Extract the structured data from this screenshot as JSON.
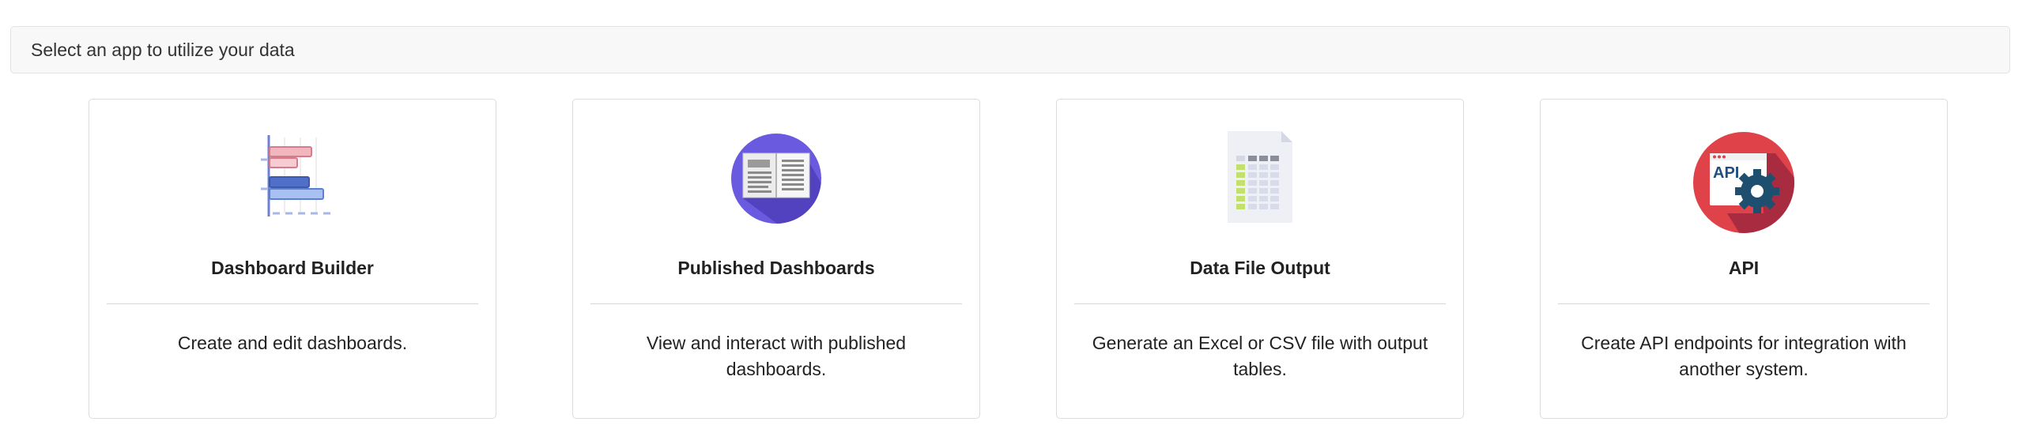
{
  "header": {
    "text": "Select an app to utilize your data"
  },
  "apps": [
    {
      "title": "Dashboard Builder",
      "description": "Create and edit dashboards.",
      "icon": "bar-chart-icon"
    },
    {
      "title": "Published Dashboards",
      "description": "View and interact with published dashboards.",
      "icon": "open-book-icon"
    },
    {
      "title": "Data File Output",
      "description": "Generate an Excel or CSV file with output tables.",
      "icon": "spreadsheet-file-icon"
    },
    {
      "title": "API",
      "description": "Create API endpoints for integration with another system.",
      "icon": "api-gear-icon",
      "icon_text": "API"
    }
  ],
  "colors": {
    "header_bg": "#f8f8f8",
    "book_circle": "#6a5ae0",
    "api_circle": "#e0424a",
    "chart_pink": "#f2b6be",
    "chart_blue": "#6d8fdc"
  }
}
